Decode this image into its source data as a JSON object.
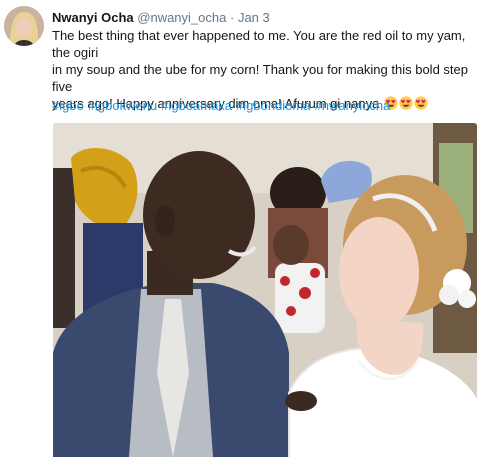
{
  "tweet": {
    "author_name": "Nwanyi Ocha",
    "handle": "@nwanyi_ocha",
    "separator": "·",
    "date": "Jan 3",
    "line1": "The best thing that ever happened to me. You are the red oil to my yam, the ogiri",
    "line2": "in my soup and the ube for my corn! Thank you for making this bold step five",
    "line3": "years ago! Happy anniversary dim oma!  Afurum gi nanya",
    "emoji": [
      "heart-eyes",
      "heart-eyes",
      "heart-eyes"
    ],
    "hashtags": [
      "#igbo",
      "#igbokwenu",
      "#igboamaka",
      "#igbondioma",
      "#nwanyiocha"
    ],
    "link_color": "#1b95e0"
  }
}
